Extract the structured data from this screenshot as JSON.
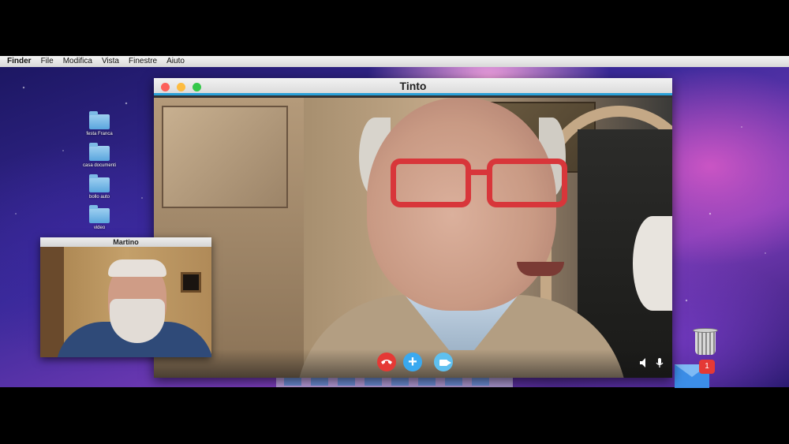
{
  "menubar": {
    "app": "Finder",
    "items": [
      "File",
      "Modifica",
      "Vista",
      "Finestre",
      "Aiuto"
    ]
  },
  "desktop": {
    "icons": [
      {
        "label": "festa Franca",
        "icon": "folder-icon"
      },
      {
        "label": "casa documenti",
        "icon": "folder-icon"
      },
      {
        "label": "bollo auto",
        "icon": "folder-icon"
      },
      {
        "label": "video",
        "icon": "folder-icon"
      }
    ]
  },
  "main_window": {
    "title": "Tinto",
    "controls": [
      "close",
      "minimize",
      "zoom"
    ],
    "accent_color": "#2aa0d8"
  },
  "call_controls": {
    "hangup_icon": "phone-hangup-icon",
    "add_icon": "plus-icon",
    "add_symbol": "+",
    "video_icon": "video-camera-icon",
    "speaker_icon": "speaker-icon",
    "mic_icon": "microphone-icon"
  },
  "pip_window": {
    "title": "Martino"
  },
  "dock": {
    "mail_badge": "1"
  },
  "colors": {
    "hangup": "#e53935",
    "add": "#3aa9f0",
    "video": "#5fc0f0",
    "badge": "#e53935"
  }
}
